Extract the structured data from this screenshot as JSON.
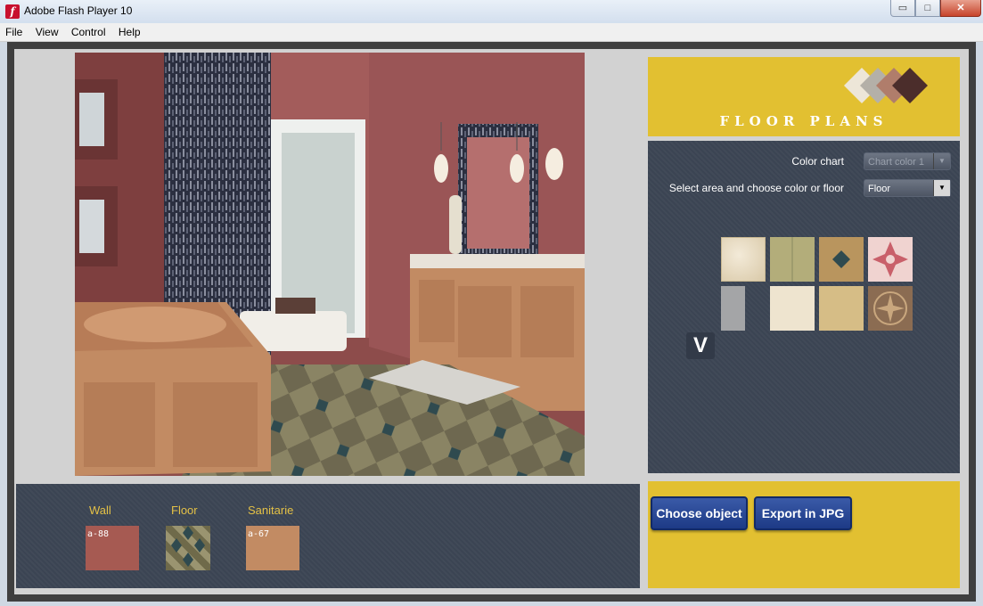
{
  "window": {
    "title": "Adobe Flash Player 10",
    "controls": {
      "minimize": "▭",
      "maximize": "□",
      "close": "✕"
    }
  },
  "menu": [
    "File",
    "View",
    "Control",
    "Help"
  ],
  "app": {
    "logo_title": "FLOOR PLANS",
    "color_chart_label": "Color chart",
    "color_chart_value": "Chart color 1",
    "area_label": "Select area and choose color or floor",
    "area_value": "Floor",
    "nav_down_icon": "chevron-down-icon",
    "tiles": [
      {
        "name": "cream-marble",
        "color": "#e8dcc6"
      },
      {
        "name": "green-beige",
        "color": "#b3ad7a"
      },
      {
        "name": "beige-diamond",
        "color": "#b9955e"
      },
      {
        "name": "pink-star",
        "color": "#d98585"
      },
      {
        "name": "grey-stone",
        "color": "#a4a5a7"
      },
      {
        "name": "ivory",
        "color": "#eee4cf"
      },
      {
        "name": "sand",
        "color": "#d6bd86"
      },
      {
        "name": "brown-rosette",
        "color": "#8b6c52"
      }
    ],
    "swatches": {
      "wall": {
        "label": "Wall",
        "code": "a-88",
        "color": "#a65a52"
      },
      "floor": {
        "label": "Floor",
        "code": "",
        "color": "#8a8460"
      },
      "sanitarie": {
        "label": "Sanitarie",
        "code": "a-67",
        "color": "#c28b63"
      }
    },
    "buttons": {
      "choose": "Choose object",
      "export": "Export in JPG"
    }
  }
}
